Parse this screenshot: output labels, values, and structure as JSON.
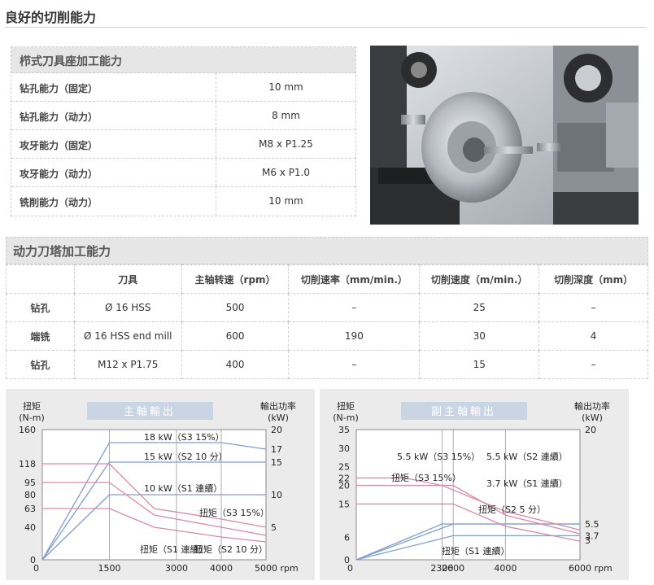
{
  "page_title": "良好的切削能力",
  "spec": {
    "header": "栉式刀具座加工能力",
    "rows": [
      {
        "label": "钻孔能力（固定）",
        "value": "10 mm"
      },
      {
        "label": "钻孔能力（动力）",
        "value": "8 mm"
      },
      {
        "label": "攻牙能力（固定）",
        "value": "M8 x P1.25"
      },
      {
        "label": "攻牙能力（动力）",
        "value": "M6 x P1.0"
      },
      {
        "label": "铣削能力（动力）",
        "value": "10 mm"
      }
    ]
  },
  "turret": {
    "header": "动力刀塔加工能力",
    "columns": [
      "",
      "刀具",
      "主轴转速（rpm）",
      "切削速率（mm/min.）",
      "切削速度（m/min.）",
      "切削深度（mm）"
    ],
    "rows": [
      [
        "钻孔",
        "Ø 16 HSS",
        "500",
        "–",
        "25",
        "–"
      ],
      [
        "端铣",
        "Ø 16 HSS end mill",
        "600",
        "190",
        "30",
        "4"
      ],
      [
        "钻孔",
        "M12 x P1.75",
        "400",
        "–",
        "15",
        "–"
      ]
    ]
  },
  "chart_data": [
    {
      "type": "line",
      "title": "主軸輸出",
      "left_axis_label": [
        "扭矩",
        "(N-m)"
      ],
      "right_axis_label": [
        "輸出功率",
        "(kW)"
      ],
      "x_unit": "rpm",
      "x_ticks": [
        0,
        1500,
        3000,
        4000,
        5000
      ],
      "x_tick_labels": [
        "0",
        "1500",
        "3000",
        "4000",
        "5000 rpm"
      ],
      "y_ticks": [
        0,
        40,
        63,
        80,
        95,
        118,
        160
      ],
      "y2_ticks": [
        5,
        10,
        15,
        17,
        20
      ],
      "xlim": [
        0,
        5000
      ],
      "ylim": [
        0,
        160
      ],
      "y2lim": [
        0,
        20
      ],
      "power_series": [
        {
          "name": "18 kW（S3 15%）",
          "points": [
            [
              0,
              0
            ],
            [
              1500,
              18
            ],
            [
              4000,
              18
            ],
            [
              5000,
              17
            ]
          ]
        },
        {
          "name": "15 kW（S2 10 分）",
          "points": [
            [
              0,
              0
            ],
            [
              1500,
              15
            ],
            [
              5000,
              15
            ]
          ]
        },
        {
          "name": "10 kW（S1 連續）",
          "points": [
            [
              0,
              0
            ],
            [
              1500,
              10
            ],
            [
              5000,
              10
            ]
          ]
        }
      ],
      "torque_series": [
        {
          "name": "扭矩（S3 15%）",
          "points": [
            [
              0,
              118
            ],
            [
              1500,
              118
            ],
            [
              2500,
              63
            ],
            [
              4000,
              50
            ],
            [
              5000,
              40
            ]
          ]
        },
        {
          "name": "扭矩（S2 10 分）",
          "points": [
            [
              0,
              95
            ],
            [
              1500,
              95
            ],
            [
              2500,
              55
            ],
            [
              4000,
              40
            ],
            [
              5000,
              30
            ]
          ]
        },
        {
          "name": "扭矩（S1 連續）",
          "points": [
            [
              0,
              63
            ],
            [
              1500,
              63
            ],
            [
              2500,
              40
            ],
            [
              4000,
              28
            ],
            [
              5000,
              22
            ]
          ]
        }
      ],
      "labels": [
        "18 kW（S3 15%）",
        "15 kW（S2 10 分）",
        "10 kW（S1 連續）",
        "扭矩（S3 15%）",
        "扭矩（S1 連續）",
        "扭矩（S2 10 分）"
      ]
    },
    {
      "type": "line",
      "title": "副主軸輸出",
      "left_axis_label": [
        "扭矩",
        "(N-m)"
      ],
      "right_axis_label": [
        "輸出功率",
        "(kW)"
      ],
      "x_unit": "rpm",
      "x_ticks": [
        0,
        2300,
        2600,
        4000,
        6000
      ],
      "x_tick_labels": [
        "0",
        "2300",
        "2600",
        "4000",
        "6000 rpm"
      ],
      "y_ticks": [
        0,
        6,
        15,
        20,
        22,
        25,
        30,
        35
      ],
      "y2_ticks": [
        3,
        3.7,
        5.5,
        20
      ],
      "xlim": [
        0,
        6000
      ],
      "ylim": [
        0,
        35
      ],
      "y2lim": [
        0,
        20
      ],
      "power_series": [
        {
          "name": "5.5 kW（S3 15%）",
          "points": [
            [
              0,
              0
            ],
            [
              2300,
              5.5
            ],
            [
              6000,
              5.5
            ]
          ]
        },
        {
          "name": "5.5 kW（S2 連續）",
          "points": [
            [
              0,
              0
            ],
            [
              2600,
              5.5
            ],
            [
              6000,
              5.5
            ]
          ]
        },
        {
          "name": "3.7 kW（S1 連續）",
          "points": [
            [
              0,
              0
            ],
            [
              2600,
              3.7
            ],
            [
              6000,
              3.7
            ]
          ]
        }
      ],
      "torque_series": [
        {
          "name": "扭矩（S3 15%）",
          "points": [
            [
              0,
              22
            ],
            [
              1300,
              22
            ],
            [
              2300,
              20
            ],
            [
              4000,
              13
            ],
            [
              6000,
              8
            ]
          ]
        },
        {
          "name": "扭矩（S2 5 分）",
          "points": [
            [
              0,
              20
            ],
            [
              2600,
              20
            ],
            [
              4000,
              12
            ],
            [
              6000,
              7
            ]
          ]
        },
        {
          "name": "扭矩（S1 連續）",
          "points": [
            [
              0,
              15
            ],
            [
              2600,
              15
            ],
            [
              4000,
              9
            ],
            [
              6000,
              5
            ]
          ]
        }
      ],
      "labels": [
        "5.5 kW（S3 15%）",
        "5.5 kW（S2 連續）",
        "扭矩（S3 15%）",
        "3.7 kW（S1 連續）",
        "扭矩（S2 5 分）",
        "扭矩（S1 連續）"
      ]
    }
  ]
}
